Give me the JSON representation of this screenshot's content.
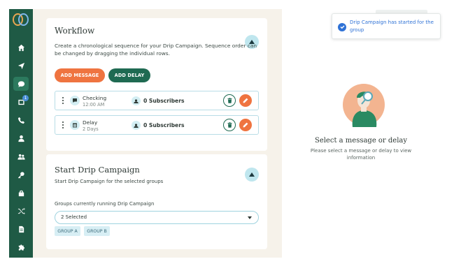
{
  "sidebar": {
    "logo": "talkroute-logo",
    "items": [
      {
        "icon": "home-icon"
      },
      {
        "icon": "send-icon"
      },
      {
        "icon": "chat-bubble-icon",
        "active": true
      },
      {
        "icon": "inbox-icon",
        "badge": "1"
      },
      {
        "icon": "phone-icon"
      },
      {
        "icon": "user-icon"
      },
      {
        "icon": "users-icon"
      },
      {
        "icon": "key-icon"
      },
      {
        "icon": "lock-icon"
      },
      {
        "icon": "shuffle-icon"
      },
      {
        "icon": "document-icon"
      },
      {
        "icon": "puzzle-icon"
      }
    ]
  },
  "workflow": {
    "title": "Workflow",
    "description": "Create a chronological sequence for your Drip Campaign. Sequence order can be changed by dragging the individual rows.",
    "add_message_label": "ADD MESSAGE",
    "add_delay_label": "ADD DELAY",
    "rows": [
      {
        "name": "Checking",
        "sub": "12:00 AM",
        "type_icon": "message-icon",
        "subscribers": "0 Subscribers"
      },
      {
        "name": "Delay",
        "sub": "2 Days",
        "type_icon": "calendar-icon",
        "subscribers": "0 Subscribers"
      }
    ]
  },
  "start_campaign": {
    "title": "Start Drip Campaign",
    "description": "Start Drip Campaign for the selected groups",
    "groups_label": "Groups currently running Drip Campaign",
    "selected_value": "2 Selected",
    "chips": [
      "GROUP A",
      "GROUP B"
    ]
  },
  "empty_state": {
    "title": "Select a message or delay",
    "description": "Please select a message or delay to view information"
  },
  "toast": {
    "message": "Drip Campaign has started for the group"
  },
  "colors": {
    "sidebar": "#1f5a45",
    "accent_orange": "#ef7440",
    "accent_green": "#1f6a52",
    "toast_blue": "#2f72d6",
    "canvas": "#f6f2ea"
  }
}
